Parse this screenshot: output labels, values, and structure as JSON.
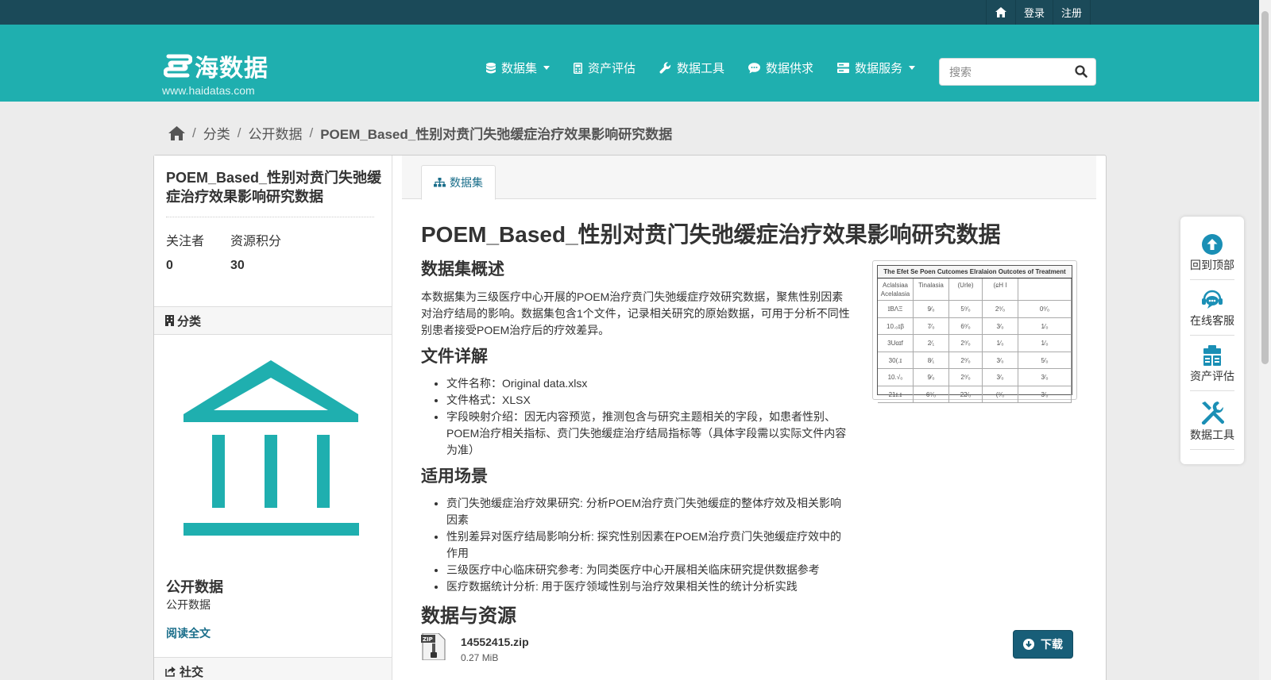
{
  "account": {
    "login": "登录",
    "register": "注册"
  },
  "brand": {
    "name": "海数据",
    "url": "www.haidatas.com"
  },
  "nav": [
    {
      "label": "数据集",
      "icon": "database-icon",
      "dropdown": true
    },
    {
      "label": "资产评估",
      "icon": "calculator-icon",
      "dropdown": false
    },
    {
      "label": "数据工具",
      "icon": "wrench-icon",
      "dropdown": false
    },
    {
      "label": "数据供求",
      "icon": "comment-icon",
      "dropdown": false
    },
    {
      "label": "数据服务",
      "icon": "server-icon",
      "dropdown": true
    }
  ],
  "search": {
    "placeholder": "搜索"
  },
  "breadcrumb": {
    "cat": "分类",
    "org": "公开数据",
    "current": "POEM_Based_性别对贲门失弛缓症治疗效果影响研究数据"
  },
  "sidebar": {
    "title": "POEM_Based_性别对贲门失弛缓症治疗效果影响研究数据",
    "followers_label": "关注者",
    "followers": "0",
    "points_label": "资源积分",
    "points": "30",
    "category_heading": "分类",
    "org_name": "公开数据",
    "org_desc": "公开数据",
    "read_more": "阅读全文",
    "social_heading": "社交"
  },
  "tab": {
    "label": "数据集"
  },
  "dataset": {
    "title": "POEM_Based_性别对贲门失弛缓症治疗效果影响研究数据",
    "overview_heading": "数据集概述",
    "overview": "本数据集为三级医疗中心开展的POEM治疗贲门失弛缓症疗效研究数据，聚焦性别因素对治疗结局的影响。数据集包含1个文件，记录相关研究的原始数据，可用于分析不同性别患者接受POEM治疗后的疗效差异。",
    "files_heading": "文件详解",
    "files": [
      "文件名称：Original data.xlsx",
      "文件格式：XLSX",
      "字段映射介绍：因无内容预览，推测包含与研究主题相关的字段，如患者性别、POEM治疗相关指标、贲门失弛缓症治疗结局指标等（具体字段需以实际文件内容为准）"
    ],
    "scenarios_heading": "适用场景",
    "scenarios": [
      "贲门失弛缓症治疗效果研究: 分析POEM治疗贲门失弛缓症的整体疗效及相关影响因素",
      "性别差异对医疗结局影响分析: 探究性别因素在POEM治疗贲门失弛缓症疗效中的作用",
      "三级医疗中心临床研究参考: 为同类医疗中心开展相关临床研究提供数据参考",
      "医疗数据统计分析: 用于医疗领域性别与治疗效果相关性的统计分析实践"
    ],
    "resources_heading": "数据与资源"
  },
  "thumbnail": {
    "title": "The Efet Se Poen Cutcomes Elralaion Outcotes of Treatment",
    "headers": [
      "Aclalsiaa Acelalasia",
      "Tinalasia",
      "(Urle)",
      "(ɕH  I",
      ""
    ],
    "rows": [
      [
        "ɪ̈ΒɅΞ",
        "9⁄₀",
        "5⁰⁄₀",
        "2⁰⁄₀",
        "0⁰⁄₀"
      ],
      [
        "10.₀ɪβ",
        "7⁄₀",
        "6⁰⁄₀",
        "3⁄₀",
        "1⁄₀"
      ],
      [
        "3Uɑɪf",
        "2⁄₁",
        "2⁰⁄₀",
        "1⁄₀",
        "1⁄₀"
      ],
      [
        "30(.ɪ",
        "8⁄₁",
        "2⁰⁄₀",
        "3⁄₀",
        "5⁄₀"
      ],
      [
        "10.√₀",
        "9⁄₀",
        "2⁰⁄₀",
        "3⁄₀",
        "3⁄₀"
      ],
      [
        "21ɪ.ɪ",
        "6⁰⁄₀",
        "22⁄₀",
        "(⁰⁄₀",
        "3⁄₀"
      ]
    ]
  },
  "resource": {
    "badge": "ZIP",
    "name": "14552415.zip",
    "size": "0.27 MiB",
    "download": "下载"
  },
  "float_tools": [
    {
      "label": "回到顶部",
      "icon": "arrow-up-circle-icon"
    },
    {
      "label": "在线客服",
      "icon": "chat-support-icon"
    },
    {
      "label": "资产评估",
      "icon": "assessment-icon"
    },
    {
      "label": "数据工具",
      "icon": "tools-icon"
    }
  ],
  "colors": {
    "topbar": "#1b4a59",
    "masthead": "#1fafaf",
    "accent": "#185e78",
    "link": "#1a6e8a"
  }
}
